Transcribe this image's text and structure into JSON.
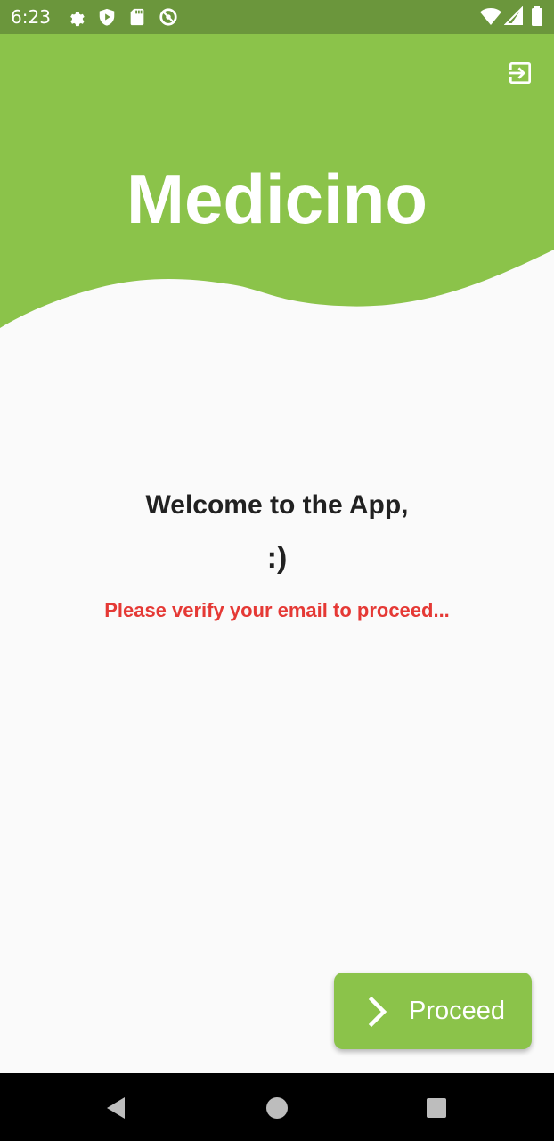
{
  "status_bar": {
    "time": "6:23",
    "icons_left": [
      "settings-icon",
      "shield-play-icon",
      "sd-card-icon",
      "no-disturb-icon"
    ],
    "icons_right": [
      "wifi-icon",
      "cell-signal-icon",
      "battery-icon"
    ],
    "background_color": "#6b963c"
  },
  "header": {
    "title": "Medicino",
    "background_color": "#8bc34a",
    "action_icon": "exit-to-app-icon"
  },
  "main": {
    "welcome": "Welcome to the App,",
    "smiley": ":)",
    "verify_message": "Please verify your email to proceed...",
    "verify_color": "#e53935"
  },
  "proceed_button": {
    "label": "Proceed",
    "icon": "chevron-right-icon",
    "color": "#8bc34a"
  },
  "nav_bar": {
    "buttons": [
      "back-icon",
      "home-icon",
      "recents-icon"
    ]
  }
}
